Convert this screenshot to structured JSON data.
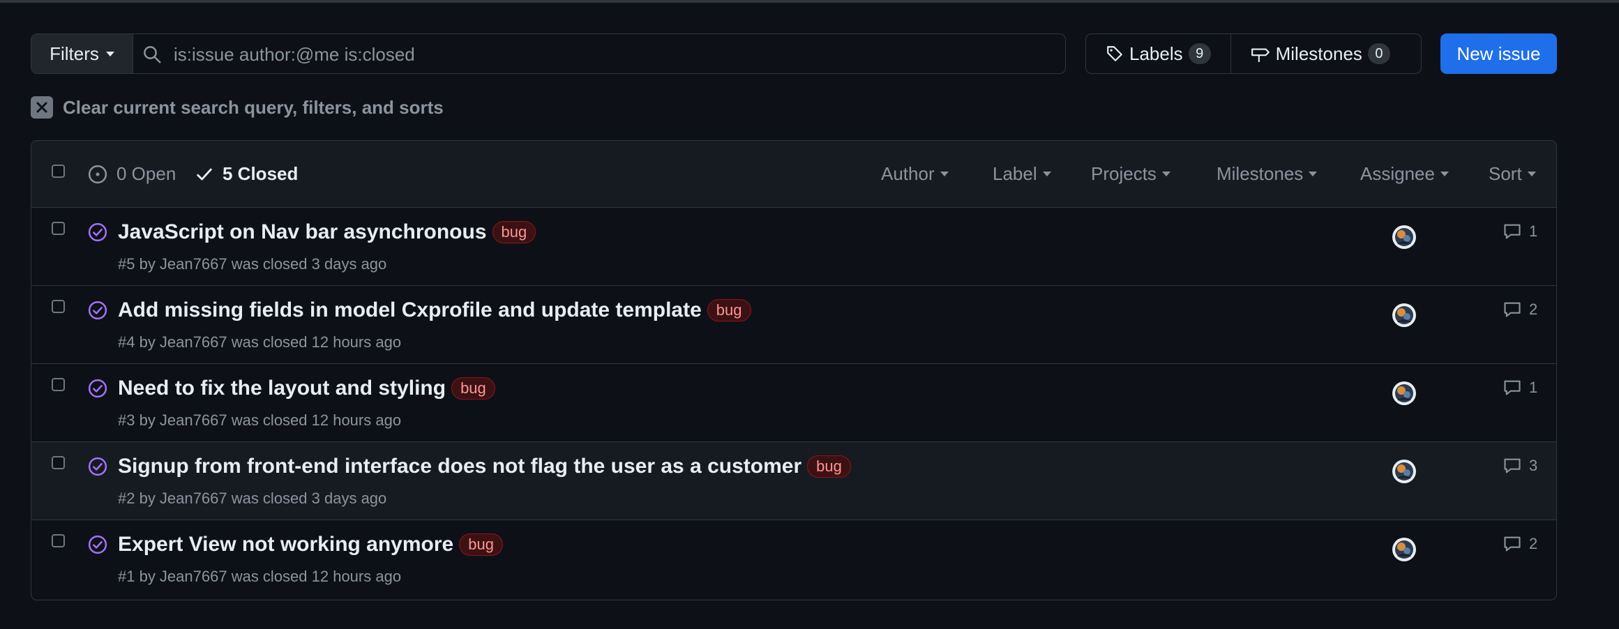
{
  "toolbar": {
    "filters_label": "Filters",
    "search_value": "is:issue author:@me is:closed",
    "labels_label": "Labels",
    "labels_count": "9",
    "milestones_label": "Milestones",
    "milestones_count": "0",
    "new_issue_label": "New issue"
  },
  "clear_filters": {
    "label": "Clear current search query, filters, and sorts"
  },
  "list_header": {
    "open_label": "0 Open",
    "closed_label": "5 Closed",
    "filters": [
      "Author",
      "Label",
      "Projects",
      "Milestones",
      "Assignee",
      "Sort"
    ]
  },
  "issues": [
    {
      "title": "JavaScript on Nav bar asynchronous",
      "label": "bug",
      "meta": "#5 by Jean7667 was closed 3 days ago",
      "comments": "1"
    },
    {
      "title": "Add missing fields in model Cxprofile and update template",
      "label": "bug",
      "meta": "#4 by Jean7667 was closed 12 hours ago",
      "comments": "2"
    },
    {
      "title": "Need to fix the layout and styling",
      "label": "bug",
      "meta": "#3 by Jean7667 was closed 12 hours ago",
      "comments": "1"
    },
    {
      "title": "Signup from front-end interface does not flag the user as a customer",
      "label": "bug",
      "meta": "#2 by Jean7667 was closed 3 days ago",
      "comments": "3"
    },
    {
      "title": "Expert View not working anymore",
      "label": "bug",
      "meta": "#1 by Jean7667 was closed 12 hours ago",
      "comments": "2"
    }
  ],
  "colors": {
    "background": "#0d1117",
    "accent": "#1f6feb",
    "closed_icon": "#a371f7",
    "bug_label": "#ff9492"
  },
  "icons": {
    "search": "search-icon",
    "labels": "tag-icon",
    "milestones": "milestone-icon",
    "open": "issue-opened-icon",
    "closed": "check-icon",
    "issue_closed": "issue-closed-icon",
    "comment": "comment-icon",
    "clear": "x-icon"
  }
}
